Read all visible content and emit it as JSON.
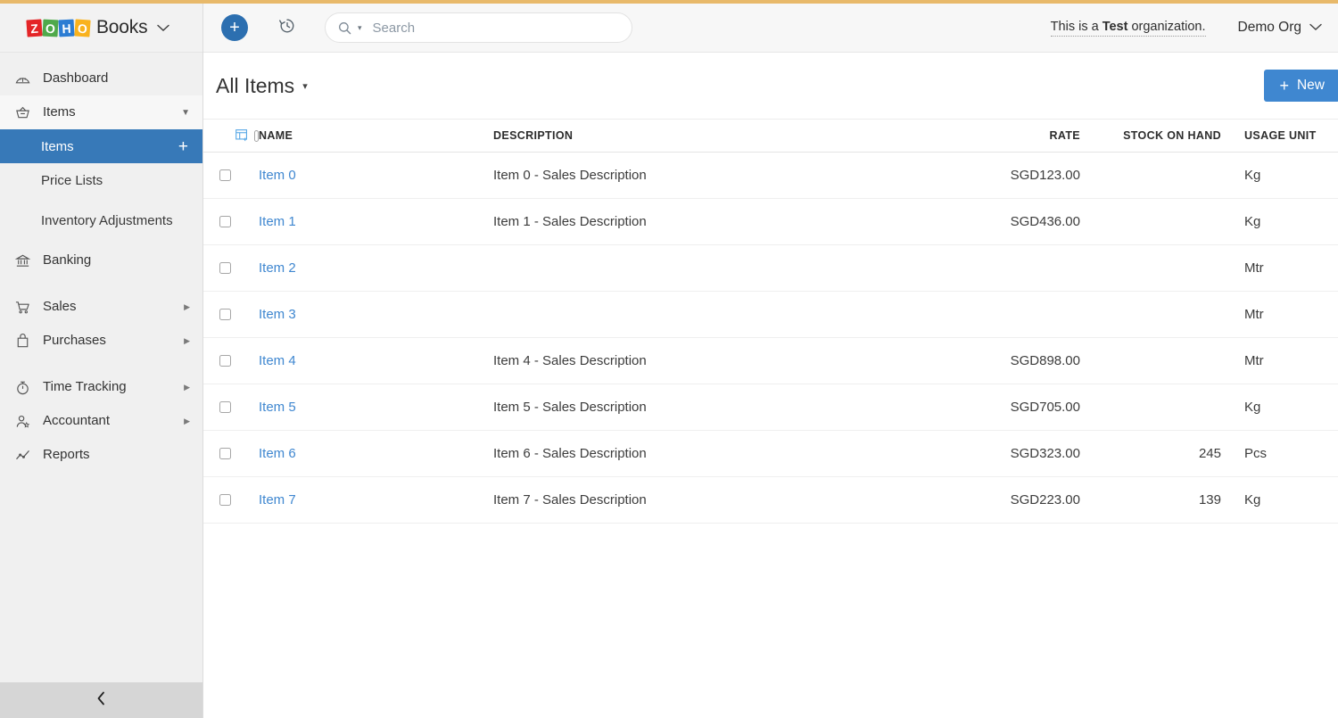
{
  "brand": {
    "logo_tiles": [
      "Z",
      "O",
      "H",
      "O"
    ],
    "name": "Books",
    "caret": "⌄",
    "colors": {
      "red": "#e42527",
      "green": "#4fa94b",
      "blue": "#2b7cd3",
      "yellow": "#f9b21d"
    }
  },
  "topbar": {
    "add_button": "+",
    "add_icon": "plus-icon",
    "history_icon": "history-clock-icon",
    "search": {
      "icon": "search-icon",
      "caret": "▾",
      "placeholder": "Search",
      "value": ""
    },
    "test_org_prefix": "This is a ",
    "test_org_bold": "Test",
    "test_org_suffix": " organization.",
    "org_name": "Demo Org",
    "org_caret": "⌄"
  },
  "sidebar": {
    "items": [
      {
        "label": "Dashboard",
        "icon": "dashboard-gauge-icon",
        "arrow": ""
      },
      {
        "label": "Items",
        "icon": "items-basket-icon",
        "arrow": "▼",
        "expanded": true
      },
      {
        "label": "Banking",
        "icon": "banking-bank-icon",
        "arrow": ""
      },
      {
        "label": "Sales",
        "icon": "sales-cart-icon",
        "arrow": "▶"
      },
      {
        "label": "Purchases",
        "icon": "purchases-bag-icon",
        "arrow": "▶"
      },
      {
        "label": "Time Tracking",
        "icon": "time-tracking-stopwatch-icon",
        "arrow": "▶"
      },
      {
        "label": "Accountant",
        "icon": "accountant-person-icon",
        "arrow": "▶"
      },
      {
        "label": "Reports",
        "icon": "reports-chart-icon",
        "arrow": ""
      }
    ],
    "subitems": [
      {
        "label": "Items",
        "active": true,
        "plus": "+"
      },
      {
        "label": "Price Lists",
        "active": false,
        "plus": ""
      },
      {
        "label": "Inventory\nAdjustments",
        "active": false,
        "plus": ""
      }
    ],
    "collapse_icon": "‹",
    "active_color": "#3779b8"
  },
  "page": {
    "title": "All Items",
    "title_caret": "▾",
    "new_button": "New",
    "new_button_plus": "+",
    "new_button_color": "#3f87d0"
  },
  "table": {
    "columns_icon": "add-column-icon",
    "select_all_checkbox": false,
    "headers": [
      "NAME",
      "DESCRIPTION",
      "RATE",
      "STOCK ON HAND",
      "USAGE UNIT"
    ],
    "rows": [
      {
        "checked": false,
        "name": "Item 0",
        "description": "Item 0 - Sales Description",
        "rate": "SGD123.00",
        "stock": "",
        "unit": "Kg"
      },
      {
        "checked": false,
        "name": "Item 1",
        "description": "Item 1 - Sales Description",
        "rate": "SGD436.00",
        "stock": "",
        "unit": "Kg"
      },
      {
        "checked": false,
        "name": "Item 2",
        "description": "",
        "rate": "",
        "stock": "",
        "unit": "Mtr"
      },
      {
        "checked": false,
        "name": "Item 3",
        "description": "",
        "rate": "",
        "stock": "",
        "unit": "Mtr"
      },
      {
        "checked": false,
        "name": "Item 4",
        "description": "Item 4 - Sales Description",
        "rate": "SGD898.00",
        "stock": "",
        "unit": "Mtr"
      },
      {
        "checked": false,
        "name": "Item 5",
        "description": "Item 5 - Sales Description",
        "rate": "SGD705.00",
        "stock": "",
        "unit": "Kg"
      },
      {
        "checked": false,
        "name": "Item 6",
        "description": "Item 6 - Sales Description",
        "rate": "SGD323.00",
        "stock": "245",
        "unit": "Pcs"
      },
      {
        "checked": false,
        "name": "Item 7",
        "description": "Item 7 - Sales Description",
        "rate": "SGD223.00",
        "stock": "139",
        "unit": "Kg"
      }
    ]
  }
}
